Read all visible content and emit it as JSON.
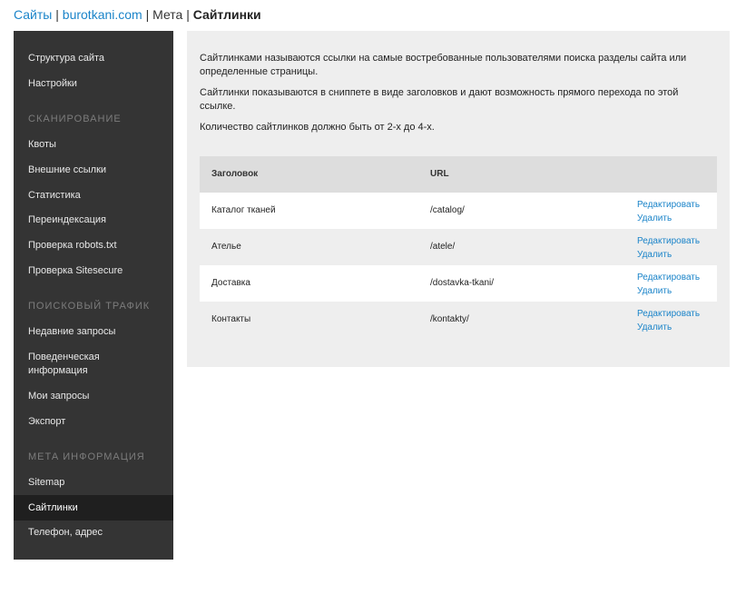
{
  "breadcrumb": {
    "root": "Сайты",
    "site": "burotkani.com",
    "section": "Мета",
    "current": "Сайтлинки",
    "separator": "|"
  },
  "sidebar": {
    "top_items": [
      "Структура сайта",
      "Настройки"
    ],
    "sections": [
      {
        "title": "Сканирование",
        "items": [
          "Квоты",
          "Внешние ссылки",
          "Статистика",
          "Переиндексация",
          "Проверка robots.txt",
          "Проверка Sitesecure"
        ]
      },
      {
        "title": "Поисковый трафик",
        "items": [
          "Недавние запросы",
          "Поведенческая информация",
          "Мои запросы",
          "Экспорт"
        ]
      },
      {
        "title": "Мета информация",
        "items": [
          "Sitemap",
          "Сайтлинки",
          "Телефон, адрес"
        ]
      }
    ],
    "active_item": "Сайтлинки"
  },
  "content": {
    "para1": "Сайтлинками называются ссылки на самые востребованные пользователями поиска разделы сайта или определенные страницы.",
    "para2": "Сайтлинки показываются в сниппете в виде заголовков и дают возможность прямого перехода по этой ссылке.",
    "para3": "Количество сайтлинков должно быть от 2-х до 4-х."
  },
  "table": {
    "headers": {
      "title": "Заголовок",
      "url": "URL"
    },
    "edit_label": "Редактировать",
    "delete_label": "Удалить",
    "rows": [
      {
        "title": "Каталог тканей",
        "url": "/catalog/"
      },
      {
        "title": "Ателье",
        "url": "/atele/"
      },
      {
        "title": "Доставка",
        "url": "/dostavka-tkani/"
      },
      {
        "title": "Контакты",
        "url": "/kontakty/"
      }
    ]
  }
}
